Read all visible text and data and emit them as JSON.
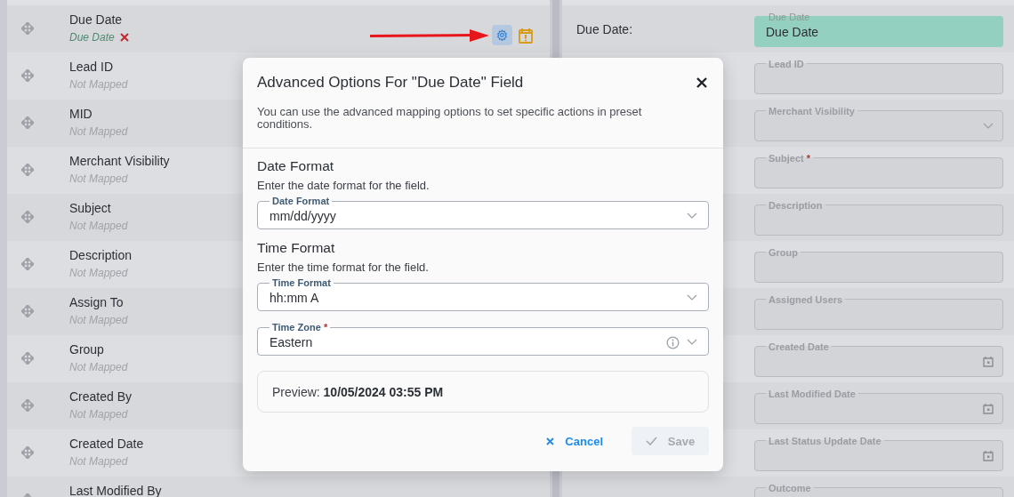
{
  "source_fields": [
    {
      "name": "Due Date",
      "mapping": "Due Date",
      "mapped": true,
      "actions": true
    },
    {
      "name": "Lead ID",
      "mapping": "Not Mapped",
      "mapped": false
    },
    {
      "name": "MID",
      "mapping": "Not Mapped",
      "mapped": false
    },
    {
      "name": "Merchant Visibility",
      "mapping": "Not Mapped",
      "mapped": false
    },
    {
      "name": "Subject",
      "mapping": "Not Mapped",
      "mapped": false
    },
    {
      "name": "Description",
      "mapping": "Not Mapped",
      "mapped": false
    },
    {
      "name": "Assign To",
      "mapping": "Not Mapped",
      "mapped": false
    },
    {
      "name": "Group",
      "mapping": "Not Mapped",
      "mapped": false
    },
    {
      "name": "Created By",
      "mapping": "Not Mapped",
      "mapped": false
    },
    {
      "name": "Created Date",
      "mapping": "Not Mapped",
      "mapped": false
    },
    {
      "name": "Last Modified By"
    }
  ],
  "target_fields": [
    {
      "label": "Due Date:",
      "field_label": "Due Date",
      "value": "Due Date",
      "kind": "text",
      "highlighted": true
    },
    {
      "field_label": "Lead ID",
      "kind": "text",
      "highlighted": false
    },
    {
      "field_label": "Merchant Visibility",
      "kind": "select",
      "highlighted": false
    },
    {
      "field_label": "Subject",
      "required_mark": "*",
      "kind": "text",
      "highlighted": false
    },
    {
      "field_label": "Description",
      "kind": "text",
      "highlighted": false
    },
    {
      "field_label": "Group",
      "kind": "text",
      "highlighted": false
    },
    {
      "field_label": "Assigned Users",
      "kind": "text",
      "highlighted": false
    },
    {
      "field_label": "Created Date",
      "kind": "date",
      "highlighted": false
    },
    {
      "field_label": "Last Modified Date",
      "kind": "date",
      "highlighted": false
    },
    {
      "field_label": "Last Status Update Date",
      "kind": "date",
      "highlighted": false
    },
    {
      "field_label": "Outcome",
      "kind": "text",
      "highlighted": false
    }
  ],
  "modal": {
    "title": "Advanced Options For \"Due Date\" Field",
    "description": "You can use the advanced mapping options to set specific actions in preset conditions.",
    "sections": [
      {
        "heading": "Date Format",
        "hint": "Enter the date format for the field.",
        "fields": [
          {
            "label": "Date Format",
            "value": "mm/dd/yyyy",
            "info": false
          }
        ]
      },
      {
        "heading": "Time Format",
        "hint": "Enter the time format for the field.",
        "fields": [
          {
            "label": "Time Format",
            "value": "hh:mm A",
            "info": false
          },
          {
            "label": "Time Zone",
            "required_mark": "*",
            "value": "Eastern",
            "info": true
          }
        ]
      }
    ],
    "preview": "Preview: **10/05/2024 03:55 PM**",
    "cancel": "Cancel",
    "save": "Save",
    "save_disabled": true
  }
}
